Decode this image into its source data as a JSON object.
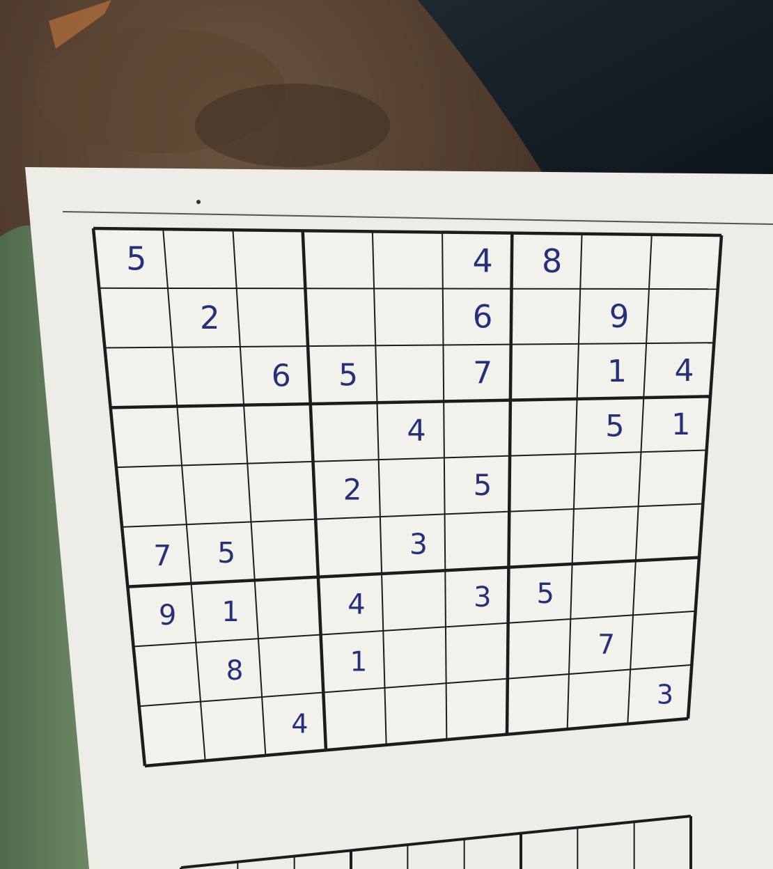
{
  "puzzle": {
    "grid": [
      [
        "5",
        "",
        "",
        "",
        "",
        "4",
        "8",
        "",
        ""
      ],
      [
        "",
        "2",
        "",
        "",
        "",
        "6",
        "",
        "9",
        ""
      ],
      [
        "",
        "",
        "6",
        "5",
        "",
        "7",
        "",
        "1",
        "4"
      ],
      [
        "",
        "",
        "",
        "",
        "4",
        "",
        "",
        "5",
        "1"
      ],
      [
        "",
        "",
        "",
        "2",
        "",
        "5",
        "",
        "",
        ""
      ],
      [
        "7",
        "5",
        "",
        "",
        "3",
        "",
        "",
        "",
        ""
      ],
      [
        "9",
        "1",
        "",
        "4",
        "",
        "3",
        "5",
        "",
        ""
      ],
      [
        "",
        "8",
        "",
        "1",
        "",
        "",
        "",
        "7",
        ""
      ],
      [
        "",
        "",
        "4",
        "",
        "",
        "",
        "",
        "",
        "3"
      ]
    ],
    "ink_color": "#24307a",
    "grid_line_color": "#1c1c1c",
    "paper_color": "#eeece6"
  }
}
